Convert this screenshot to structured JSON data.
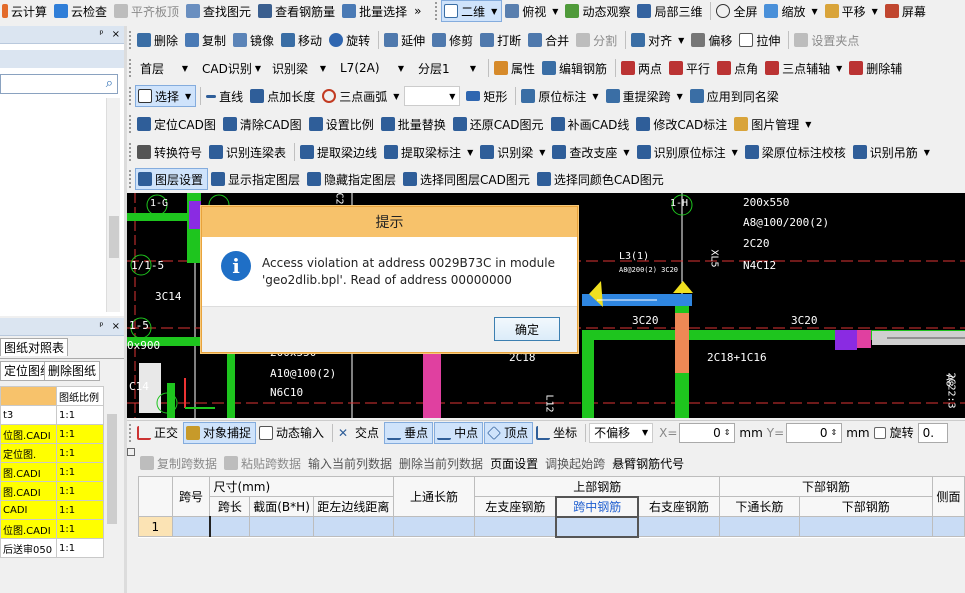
{
  "toolbar1": {
    "calc": "云计算",
    "check": "云检查",
    "flat_top": "平齐板顶",
    "find": "查找图元",
    "view_rebar": "查看钢筋量",
    "batch_select": "批量选择",
    "more": "»",
    "view2d": "二维",
    "top_view": "俯视",
    "dynamic": "动态观察",
    "local3d": "局部三维",
    "fullscreen": "全屏",
    "zoom": "缩放",
    "pan": "平移",
    "screen": "屏幕"
  },
  "toolbar2": {
    "delete": "删除",
    "copy": "复制",
    "mirror": "镜像",
    "move": "移动",
    "rotate": "旋转",
    "extend": "延伸",
    "trim": "修剪",
    "break": "打断",
    "merge": "合并",
    "split": "分割",
    "align": "对齐",
    "offset": "偏移",
    "stretch": "拉伸",
    "set_node": "设置夹点"
  },
  "toolbar3": {
    "floor": "首层",
    "cad_rec": "CAD识别",
    "rec_beam": "识别梁",
    "beam_id": "L7(2A)",
    "layer": "分层1",
    "props": "属性",
    "edit_rebar": "编辑钢筋",
    "two_points": "两点",
    "parallel": "平行",
    "corner": "点角",
    "three_pt_aux": "三点辅轴",
    "delete_aux": "删除辅"
  },
  "toolbar4": {
    "select": "选择",
    "line": "直线",
    "point_len": "点加长度",
    "three_pt_arc": "三点画弧",
    "rect": "矩形",
    "orig_annot": "原位标注",
    "re_extract_span": "重提梁跨",
    "apply_same_beam": "应用到同名梁"
  },
  "toolbar5": {
    "locate_cad": "定位CAD图",
    "clear_cad": "清除CAD图",
    "set_scale": "设置比例",
    "batch_replace": "批量替换",
    "restore_cad": "还原CAD图元",
    "patch_cad": "补画CAD线",
    "modify_cad_annot": "修改CAD标注",
    "pic_manage": "图片管理"
  },
  "toolbar6": {
    "convert_symbol": "转换符号",
    "rec_cont_table": "识别连梁表",
    "extract_beam_edge": "提取梁边线",
    "extract_beam_annot": "提取梁标注",
    "rec_beam": "识别梁",
    "check_support": "查改支座",
    "rec_orig_annot": "识别原位标注",
    "beam_annot_check": "梁原位标注校核",
    "rec_hanger": "识别吊筋"
  },
  "toolbar7": {
    "layer_settings": "图层设置",
    "show_layer": "显示指定图层",
    "hide_layer": "隐藏指定图层",
    "select_same_layer": "选择同图层CAD图元",
    "select_same_color": "选择同颜色CAD图元"
  },
  "left_panel": {
    "pin1": "ᵖ",
    "close1": "×",
    "search_icon": "⌕",
    "tab_ref": "图纸对照表",
    "pin2": "ᵖ",
    "close2": "×",
    "btn_locate": "定位图纸",
    "btn_delete": "删除图纸",
    "col_scale": "图纸比例",
    "rows": [
      {
        "name": "t3",
        "scale": "1:1",
        "hl": false
      },
      {
        "name": "位图.CADI",
        "scale": "1:1",
        "hl": true
      },
      {
        "name": "定位图.",
        "scale": "1:1",
        "hl": true
      },
      {
        "name": "图.CADI",
        "scale": "1:1",
        "hl": true
      },
      {
        "name": "图.CADI",
        "scale": "1:1",
        "hl": true
      },
      {
        "name": "CADI",
        "scale": "1:1",
        "hl": true
      },
      {
        "name": "位图.CADI",
        "scale": "1:1",
        "hl": true
      },
      {
        "name": "后送审050",
        "scale": "1:1",
        "hl": false
      }
    ]
  },
  "canvas": {
    "labels": [
      "200x550",
      "A8@100/200(2)",
      "2C20",
      "N4C12",
      "3C14",
      "1-5",
      "0x900",
      "C14",
      "200x550",
      "A10@100(2)",
      "N6C10",
      "2C18",
      "3C20",
      "3C20",
      "2C18+1C16",
      "L3(1)",
      "A8@200(2) 3C20",
      "XL5",
      "1/1-5",
      "1-H",
      "1-G",
      "C22",
      "L12",
      "A8",
      "2C22:3"
    ]
  },
  "dialog": {
    "title": "提示",
    "message": "Access violation at address 0029B73C in module 'geo2dlib.bpl'. Read of address 00000000",
    "ok": "确定"
  },
  "snapbar": {
    "ortho": "正交",
    "obj_snap": "对象捕捉",
    "dyn_input": "动态输入",
    "intersection": "交点",
    "midpoint": "垂点",
    "center": "中点",
    "vertex": "顶点",
    "coord": "坐标",
    "no_offset": "不偏移",
    "x_label": "X=",
    "x_val": "0",
    "unit": "mm",
    "y_label": "Y=",
    "y_val": "0",
    "rotate_label": "旋转",
    "rot_val": "0."
  },
  "grid_toolbar": {
    "copy_span": "复制跨数据",
    "paste_span": "粘贴跨数据",
    "input_col": "输入当前列数据",
    "delete_col": "删除当前列数据",
    "page_setup": "页面设置",
    "adjust_start": "调换起始跨",
    "cantilever": "悬臂钢筋代号"
  },
  "table": {
    "span_no": "跨号",
    "size_group": "尺寸(mm)",
    "span_len": "跨长",
    "section": "截面(B*H)",
    "dist_left": "距左边线距离",
    "top_through": "上通长筋",
    "top_rebar": "上部钢筋",
    "left_support": "左支座钢筋",
    "mid_span": "跨中钢筋",
    "right_support": "右支座钢筋",
    "bottom_rebar": "下部钢筋",
    "bottom_through": "下通长筋",
    "bottom_rebar2": "下部钢筋",
    "side": "侧面",
    "row1": "1"
  }
}
